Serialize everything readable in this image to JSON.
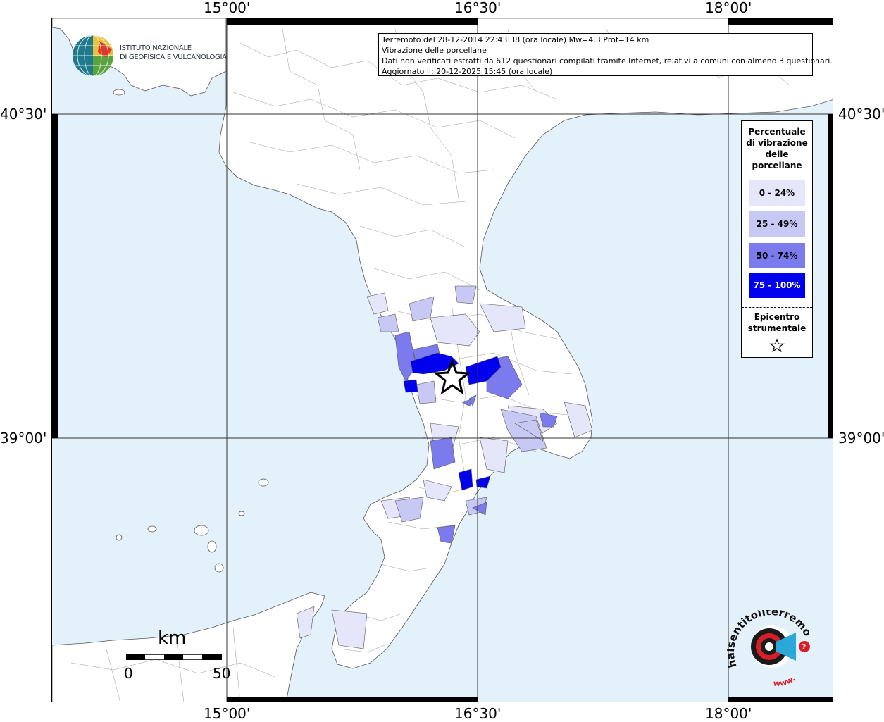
{
  "coordinates": {
    "lon_top": [
      "15°00'",
      "16°30'",
      "18°00'"
    ],
    "lon_bottom": [
      "15°00'",
      "16°30'",
      "18°00'"
    ],
    "lat_left": [
      "40°30'",
      "39°00'"
    ],
    "lat_right": [
      "40°30'",
      "39°00'"
    ]
  },
  "info": {
    "line1": "Terremoto del 28-12-2014 22:43:38 (ora locale) Mw=4.3 Prof=14 km",
    "line2": "Vibrazione delle porcellane",
    "line3": "Dati non verificati estratti da 612 questionari compilati tramite Internet, relativi a comuni con almeno 3 questionari.",
    "line4": "Aggiornato il: 20-12-2025 15:45 (ora locale)"
  },
  "legend": {
    "title": [
      "Percentuale",
      "di vibrazione",
      "delle",
      "porcellane"
    ],
    "classes": [
      {
        "label": "0 - 24%",
        "color": "#e6e6fa",
        "text_color": "#000000"
      },
      {
        "label": "25 - 49%",
        "color": "#c8c8f5",
        "text_color": "#000000"
      },
      {
        "label": "50 - 74%",
        "color": "#7b7bee",
        "text_color": "#000000"
      },
      {
        "label": "75 - 100%",
        "color": "#0000ee",
        "text_color": "#ffffff"
      }
    ],
    "epicenter_title": [
      "Epicentro",
      "strumentale"
    ],
    "epicenter_icon": "star-icon"
  },
  "ingv_logo": {
    "line1": "ISTITUTO NAZIONALE",
    "line2": "DI GEOFISICA E VULCANOLOGIA"
  },
  "scale_bar": {
    "unit": "km",
    "start": "0",
    "end": "50"
  },
  "hsit_logo": {
    "text": "haisentitoilterremoto.it",
    "url": "www."
  },
  "colors": {
    "sea": "#e3f1fa",
    "land": "#ffffff",
    "grid": "#333333"
  }
}
